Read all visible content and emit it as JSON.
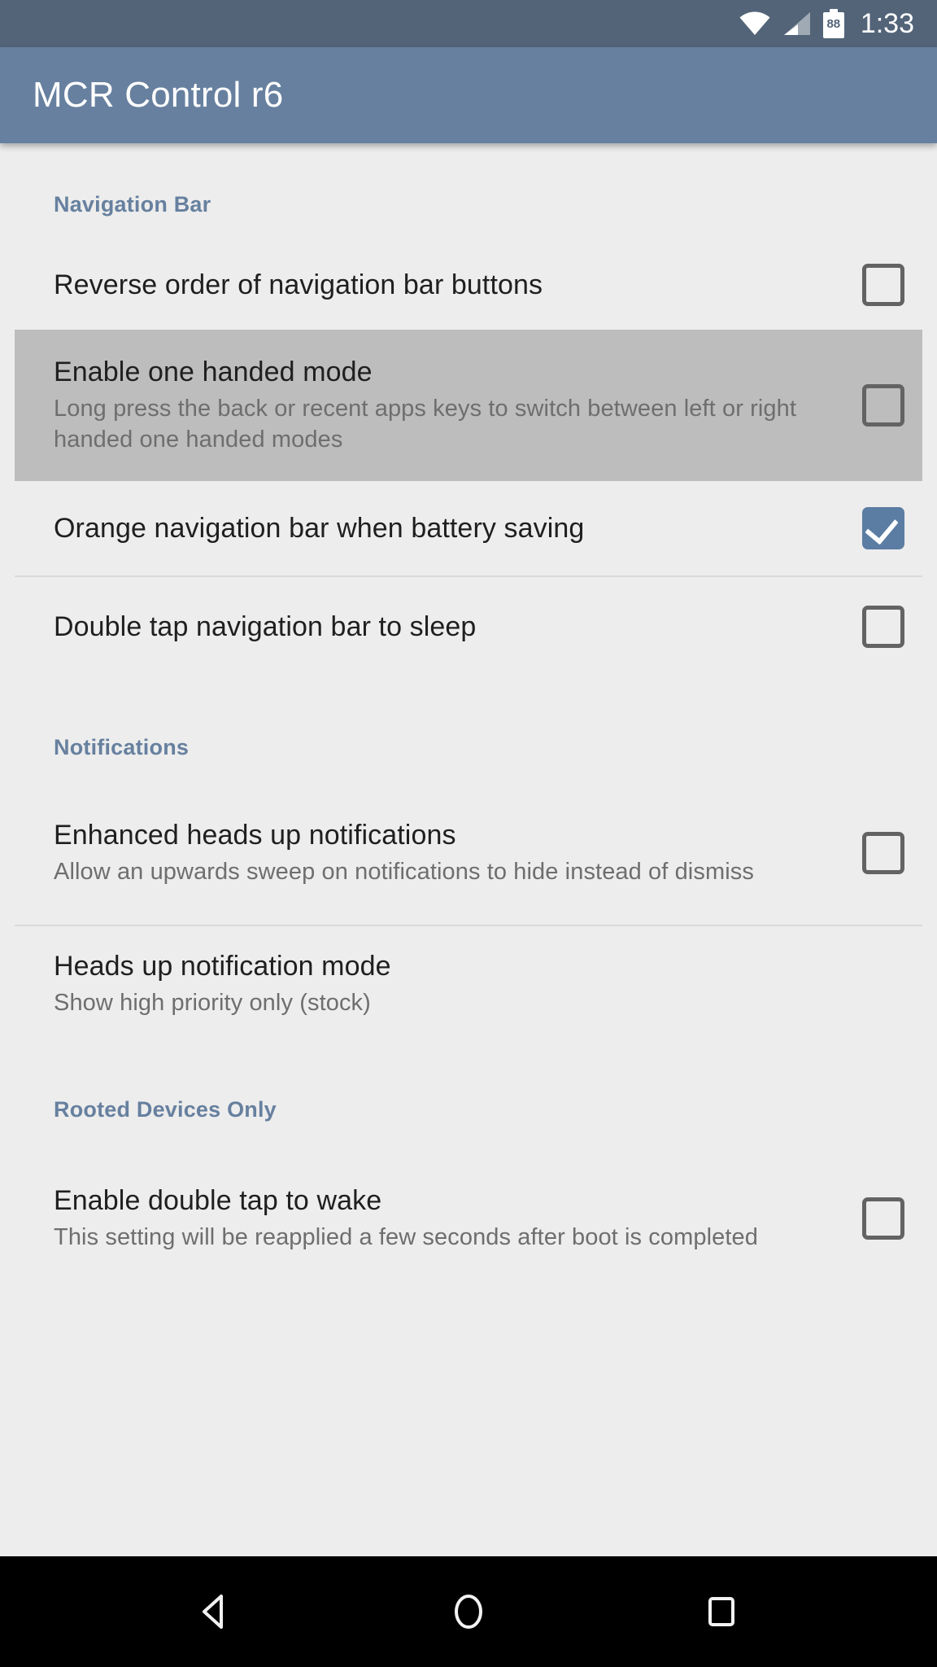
{
  "status_bar": {
    "wifi_icon": "wifi-icon",
    "signal_icon": "cellular-signal-icon",
    "battery_icon": "battery-icon",
    "battery_level": "88",
    "clock": "1:33"
  },
  "app_bar": {
    "title": "MCR Control r6"
  },
  "colors": {
    "app_bar": "#67809f",
    "status_bar": "#536479",
    "accent": "#67809f",
    "page_background": "#ededed",
    "highlight_row": "#bdbdbd",
    "checkbox_checked": "#5b7da4",
    "checkbox_border": "#636363",
    "title_text": "#1f1f1f",
    "summary_text": "#6e6e6e",
    "divider": "#dadada",
    "nav_bar": "#000000"
  },
  "sections": [
    {
      "header": "Navigation Bar",
      "items": [
        {
          "title": "Reverse order of navigation bar buttons",
          "summary": "",
          "checkbox": "unchecked",
          "highlighted": false
        },
        {
          "title": "Enable one handed mode",
          "summary": "Long press the back or recent apps keys to switch between left or right handed one handed modes",
          "checkbox": "unchecked",
          "highlighted": true
        },
        {
          "title": "Orange navigation bar when battery saving",
          "summary": "",
          "checkbox": "checked",
          "highlighted": false
        },
        {
          "title": "Double tap navigation bar to sleep",
          "summary": "",
          "checkbox": "unchecked",
          "highlighted": false
        }
      ]
    },
    {
      "header": "Notifications",
      "items": [
        {
          "title": "Enhanced heads up notifications",
          "summary": "Allow an upwards sweep on notifications to hide instead of dismiss",
          "checkbox": "unchecked",
          "highlighted": false
        },
        {
          "title": "Heads up notification mode",
          "summary": "Show high priority only (stock)",
          "checkbox": "none",
          "highlighted": false
        }
      ]
    },
    {
      "header": "Rooted Devices Only",
      "items": [
        {
          "title": "Enable double tap to wake",
          "summary": "This setting will be reapplied a few seconds after boot is completed",
          "checkbox": "unchecked",
          "highlighted": false
        }
      ]
    }
  ],
  "nav_bar": {
    "back": "back-icon",
    "home": "home-icon",
    "recents": "recents-icon"
  }
}
